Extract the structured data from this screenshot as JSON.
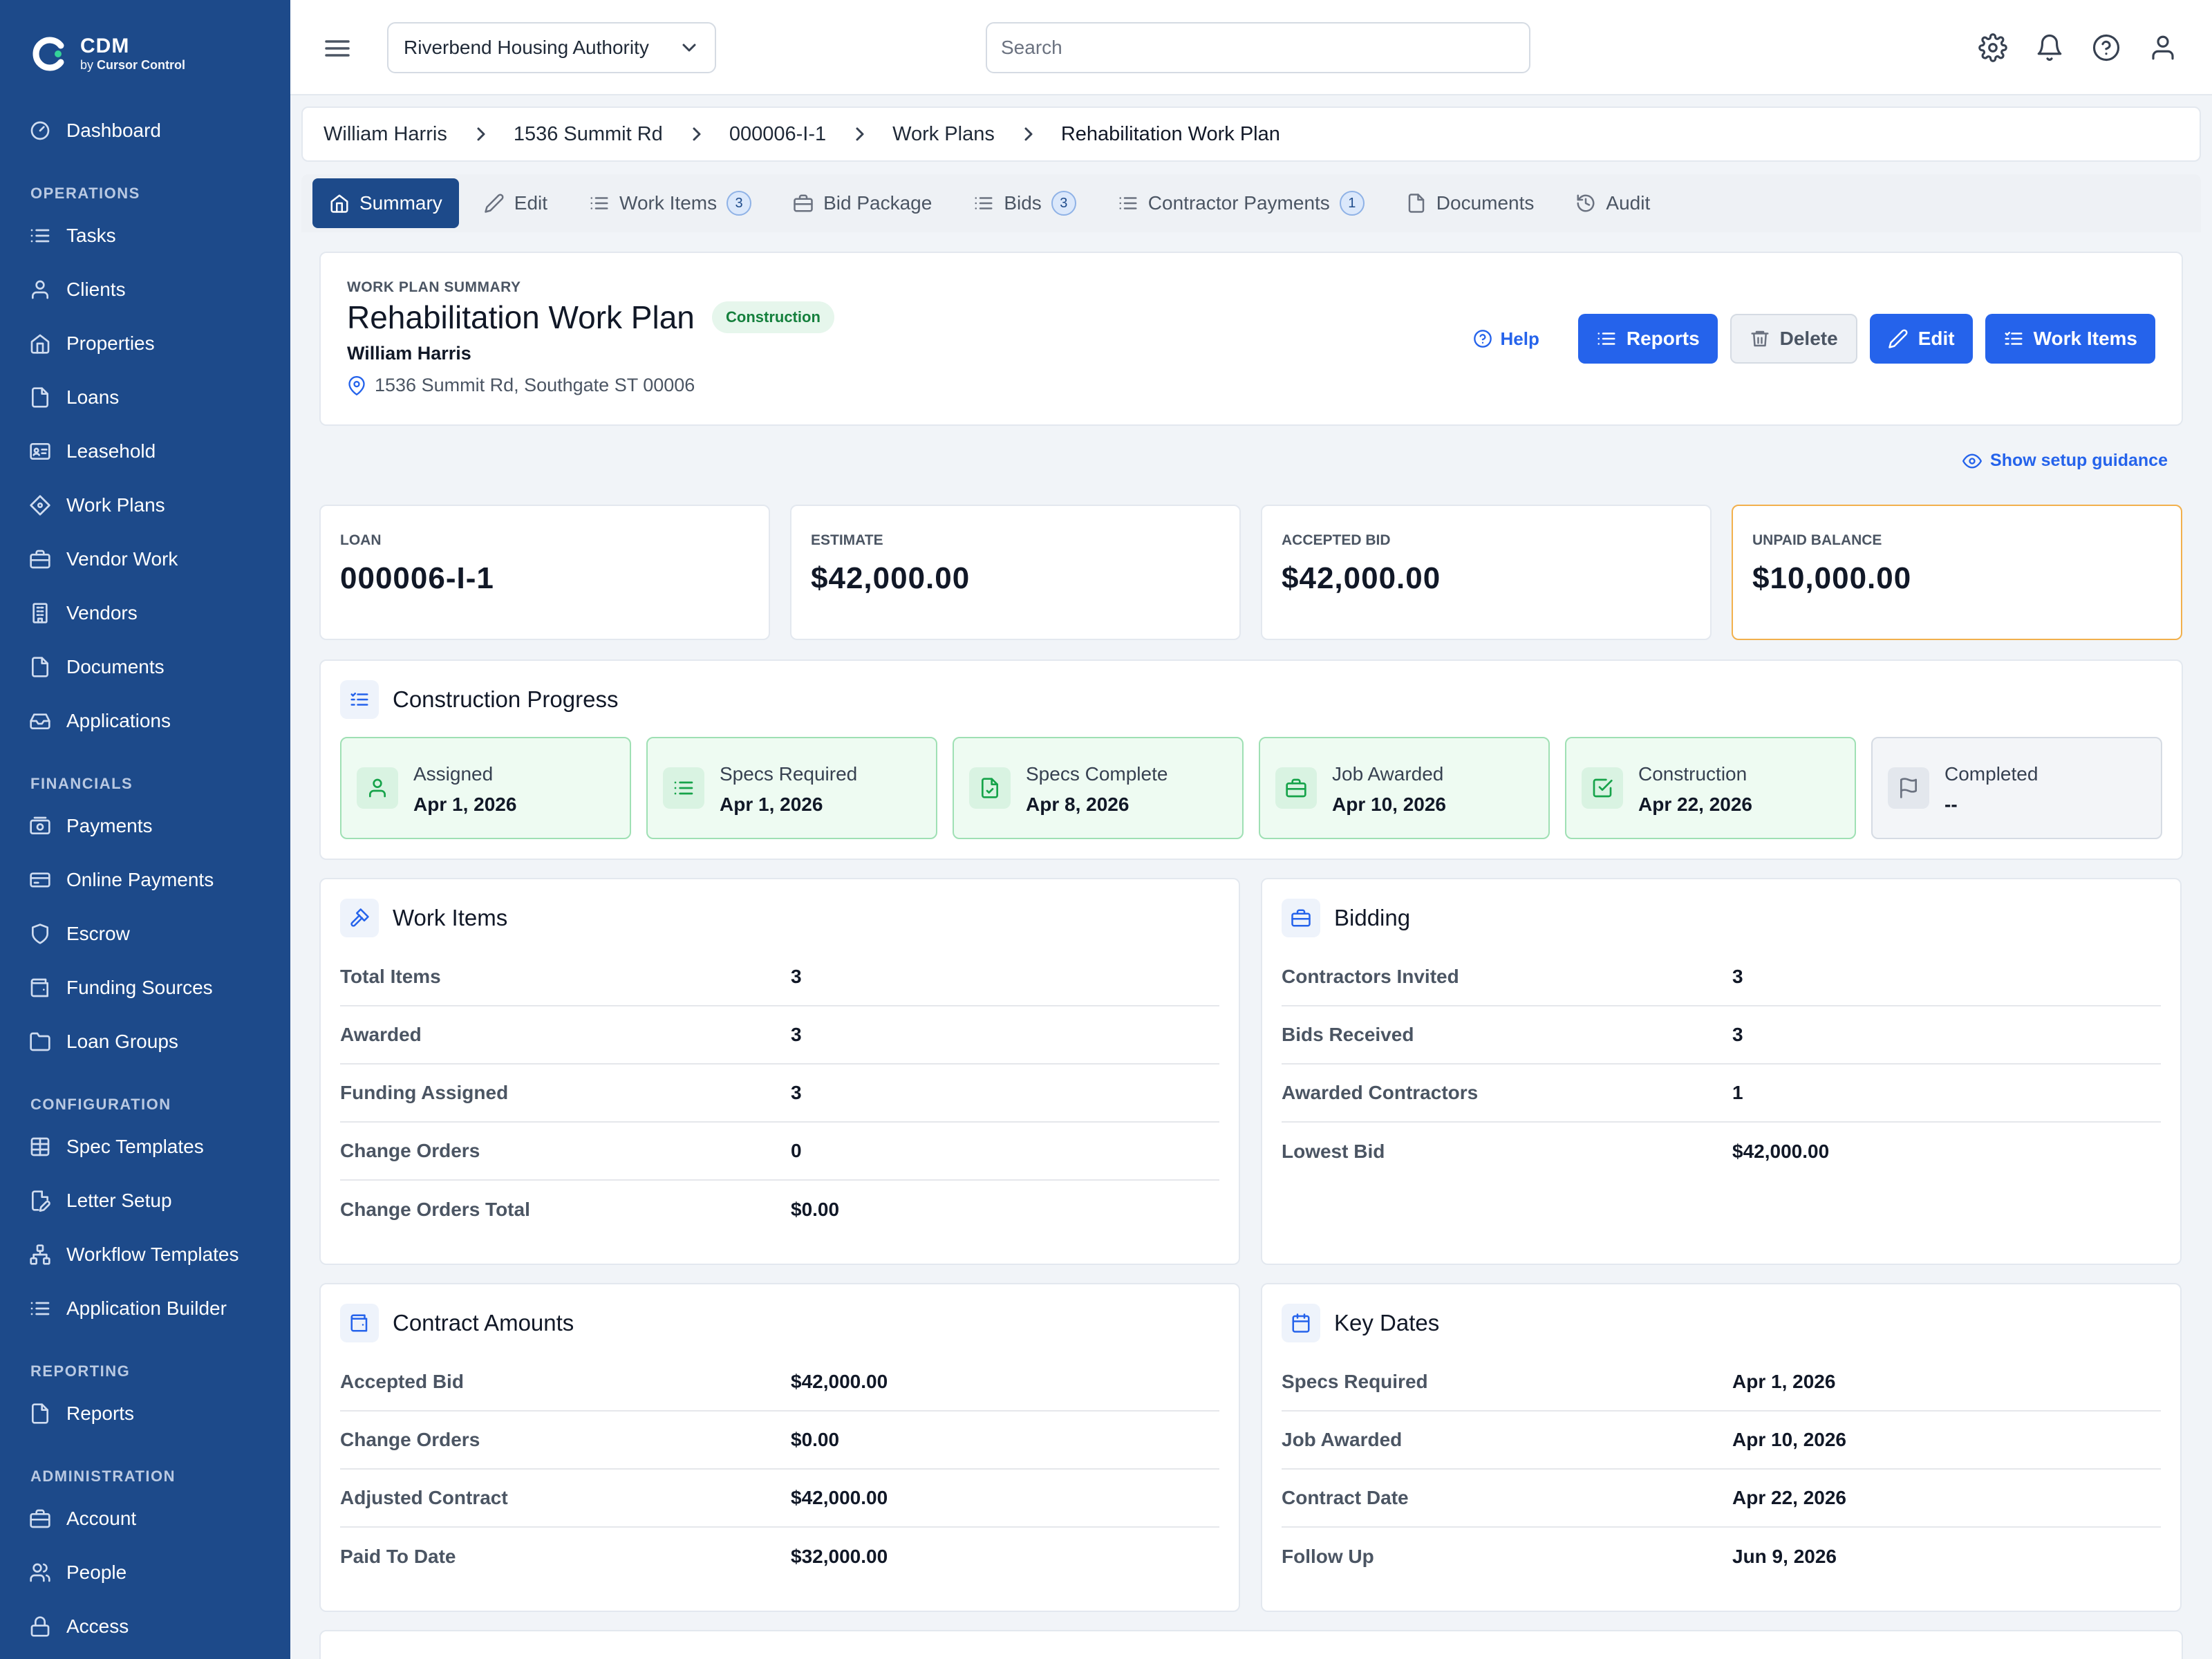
{
  "app": {
    "name": "CDM",
    "byline_prefix": "by",
    "byline_brand": "Cursor Control"
  },
  "sidebar": {
    "items": [
      {
        "label": "Dashboard",
        "icon": "dashboard-icon"
      },
      {
        "section": "OPERATIONS"
      },
      {
        "label": "Tasks",
        "icon": "list-icon"
      },
      {
        "label": "Clients",
        "icon": "user-icon"
      },
      {
        "label": "Properties",
        "icon": "home-icon"
      },
      {
        "label": "Loans",
        "icon": "file-icon"
      },
      {
        "label": "Leasehold",
        "icon": "id-card-icon"
      },
      {
        "label": "Work Plans",
        "icon": "diamond-icon"
      },
      {
        "label": "Vendor Work",
        "icon": "briefcase-icon"
      },
      {
        "label": "Vendors",
        "icon": "building-icon"
      },
      {
        "label": "Documents",
        "icon": "file-icon"
      },
      {
        "label": "Applications",
        "icon": "inbox-icon"
      },
      {
        "section": "FINANCIALS"
      },
      {
        "label": "Payments",
        "icon": "payments-icon"
      },
      {
        "label": "Online Payments",
        "icon": "credit-card-icon"
      },
      {
        "label": "Escrow",
        "icon": "shield-icon"
      },
      {
        "label": "Funding Sources",
        "icon": "wallet-icon"
      },
      {
        "label": "Loan Groups",
        "icon": "folder-icon"
      },
      {
        "section": "CONFIGURATION"
      },
      {
        "label": "Spec Templates",
        "icon": "table-icon"
      },
      {
        "label": "Letter Setup",
        "icon": "file-edit-icon"
      },
      {
        "label": "Workflow Templates",
        "icon": "workflow-icon"
      },
      {
        "label": "Application Builder",
        "icon": "list-icon"
      },
      {
        "section": "REPORTING"
      },
      {
        "label": "Reports",
        "icon": "file-icon"
      },
      {
        "section": "ADMINISTRATION"
      },
      {
        "label": "Account",
        "icon": "briefcase-icon"
      },
      {
        "label": "People",
        "icon": "people-icon"
      },
      {
        "label": "Access",
        "icon": "lock-icon"
      }
    ]
  },
  "topbar": {
    "org": "Riverbend Housing Authority",
    "search_placeholder": "Search"
  },
  "breadcrumb": [
    "William Harris",
    "1536 Summit Rd",
    "000006-I-1",
    "Work Plans",
    "Rehabilitation Work Plan"
  ],
  "tabs": [
    {
      "label": "Summary",
      "icon": "home-icon",
      "active": true
    },
    {
      "label": "Edit",
      "icon": "pencil-icon"
    },
    {
      "label": "Work Items",
      "icon": "list-icon",
      "badge": "3"
    },
    {
      "label": "Bid Package",
      "icon": "briefcase-icon"
    },
    {
      "label": "Bids",
      "icon": "list-icon",
      "badge": "3"
    },
    {
      "label": "Contractor Payments",
      "icon": "list-icon",
      "badge": "1"
    },
    {
      "label": "Documents",
      "icon": "file-icon"
    },
    {
      "label": "Audit",
      "icon": "history-icon"
    }
  ],
  "summary": {
    "label": "WORK PLAN SUMMARY",
    "title": "Rehabilitation Work Plan",
    "tag": "Construction",
    "client": "William Harris",
    "address": "1536 Summit Rd, Southgate ST 00006",
    "help": "Help",
    "buttons": {
      "reports": "Reports",
      "delete": "Delete",
      "edit": "Edit",
      "work_items": "Work Items"
    }
  },
  "guidance": "Show setup guidance",
  "stats": [
    {
      "label": "LOAN",
      "value": "000006-I-1"
    },
    {
      "label": "ESTIMATE",
      "value": "$42,000.00"
    },
    {
      "label": "ACCEPTED BID",
      "value": "$42,000.00"
    },
    {
      "label": "UNPAID BALANCE",
      "value": "$10,000.00"
    }
  ],
  "progress": {
    "title": "Construction Progress",
    "stages": [
      {
        "name": "Assigned",
        "date": "Apr 1, 2026",
        "done": true,
        "icon": "user-icon"
      },
      {
        "name": "Specs Required",
        "date": "Apr 1, 2026",
        "done": true,
        "icon": "list-icon"
      },
      {
        "name": "Specs Complete",
        "date": "Apr 8, 2026",
        "done": true,
        "icon": "file-check-icon"
      },
      {
        "name": "Job Awarded",
        "date": "Apr 10, 2026",
        "done": true,
        "icon": "briefcase-icon"
      },
      {
        "name": "Construction",
        "date": "Apr 22, 2026",
        "done": true,
        "icon": "checkbox-icon"
      },
      {
        "name": "Completed",
        "date": "--",
        "done": false,
        "icon": "flag-icon"
      }
    ]
  },
  "work_items": {
    "title": "Work Items",
    "rows": [
      {
        "key": "Total Items",
        "value": "3"
      },
      {
        "key": "Awarded",
        "value": "3"
      },
      {
        "key": "Funding Assigned",
        "value": "3"
      },
      {
        "key": "Change Orders",
        "value": "0"
      },
      {
        "key": "Change Orders Total",
        "value": "$0.00"
      }
    ]
  },
  "bidding": {
    "title": "Bidding",
    "rows": [
      {
        "key": "Contractors Invited",
        "value": "3"
      },
      {
        "key": "Bids Received",
        "value": "3"
      },
      {
        "key": "Awarded Contractors",
        "value": "1"
      },
      {
        "key": "Lowest Bid",
        "value": "$42,000.00"
      }
    ]
  },
  "contract_amounts": {
    "title": "Contract Amounts",
    "rows": [
      {
        "key": "Accepted Bid",
        "value": "$42,000.00"
      },
      {
        "key": "Change Orders",
        "value": "$0.00"
      },
      {
        "key": "Adjusted Contract",
        "value": "$42,000.00"
      },
      {
        "key": "Paid To Date",
        "value": "$32,000.00"
      }
    ]
  },
  "key_dates": {
    "title": "Key Dates",
    "rows": [
      {
        "key": "Specs Required",
        "value": "Apr 1, 2026"
      },
      {
        "key": "Job Awarded",
        "value": "Apr 10, 2026"
      },
      {
        "key": "Contract Date",
        "value": "Apr 22, 2026"
      },
      {
        "key": "Follow Up",
        "value": "Jun 9, 2026"
      }
    ]
  },
  "colors": {
    "sidebar": "#1d4a8a",
    "primary": "#2563eb",
    "success": "#15803d",
    "warning_border": "#f2b04c"
  }
}
